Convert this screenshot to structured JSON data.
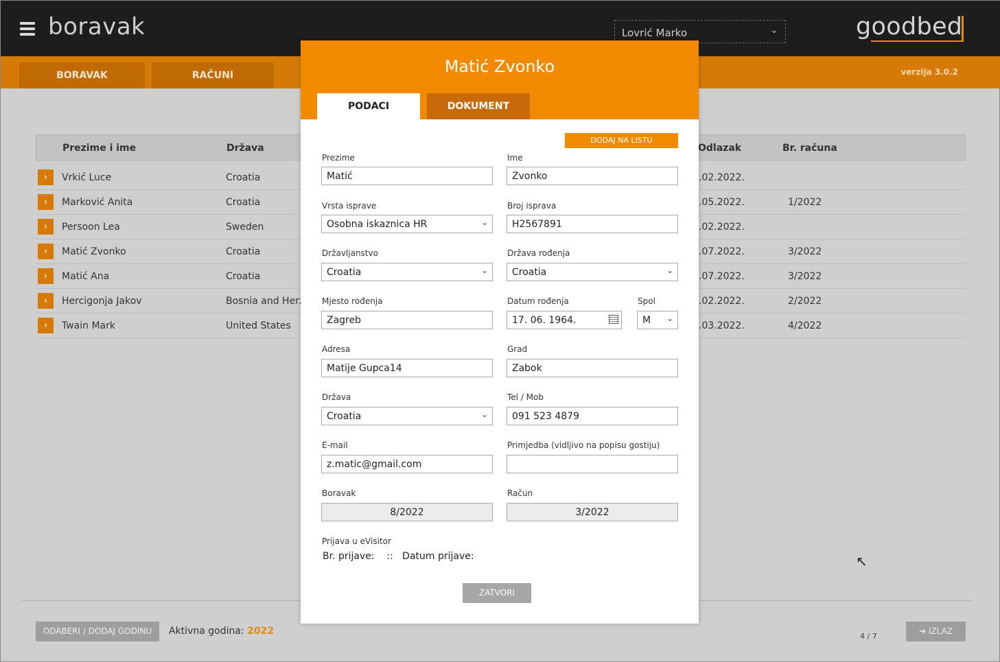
{
  "app": {
    "title": "boravak",
    "logo": "goodbed",
    "version": "verzija 3.0.2",
    "user": "Lovrić Marko"
  },
  "nav": {
    "tabs": [
      "BORAVAK",
      "RAČUNI"
    ]
  },
  "table": {
    "headers": {
      "name": "Prezime i ime",
      "country": "Država",
      "departure": "Odlazak",
      "invoice": "Br. računa"
    },
    "rows": [
      {
        "name": "Vrkić Luce",
        "country": "Croatia",
        "departure": ".02.2022.",
        "invoice": ""
      },
      {
        "name": "Marković Anita",
        "country": "Croatia",
        "departure": ".05.2022.",
        "invoice": "1/2022"
      },
      {
        "name": "Persoon Lea",
        "country": "Sweden",
        "departure": ".02.2022.",
        "invoice": ""
      },
      {
        "name": "Matić Zvonko",
        "country": "Croatia",
        "departure": ".07.2022.",
        "invoice": "3/2022"
      },
      {
        "name": "Matić Ana",
        "country": "Croatia",
        "departure": ".07.2022.",
        "invoice": "3/2022"
      },
      {
        "name": "Hercigonja Jakov",
        "country": "Bosnia and Herzeg",
        "departure": ".02.2022.",
        "invoice": "2/2022"
      },
      {
        "name": "Twain Mark",
        "country": "United States",
        "departure": ".03.2022.",
        "invoice": "4/2022"
      }
    ]
  },
  "footer": {
    "year_button": "ODABERI / DODAJ GODINU",
    "active_year_label": "Aktivna godina:",
    "active_year": "2022",
    "pager": "4 / 7",
    "exit": "IZLAZ"
  },
  "modal": {
    "title": "Matić Zvonko",
    "tabs": {
      "data": "PODACI",
      "document": "DOKUMENT"
    },
    "add_button": "DODAJ NA LISTU",
    "labels": {
      "surname": "Prezime",
      "name": "Ime",
      "doc_type": "Vrsta isprave",
      "doc_number": "Broj isprava",
      "citizenship": "Državljanstvo",
      "birth_country": "Država rođenja",
      "birth_place": "Mjesto rođenja",
      "birth_date": "Datum rođenja",
      "gender": "Spol",
      "address": "Adresa",
      "city": "Grad",
      "country": "Država",
      "phone": "Tel / Mob",
      "email": "E-mail",
      "note": "Primjedba (vidljivo na popisu gostiju)",
      "stay": "Boravak",
      "invoice": "Račun",
      "evisitor": "Prijava u eVisitor"
    },
    "values": {
      "surname": "Matić",
      "name": "Zvonko",
      "doc_type": "Osobna iskaznica HR",
      "doc_number": "H2567891",
      "citizenship": "Croatia",
      "birth_country": "Croatia",
      "birth_place": "Zagreb",
      "birth_date": "17. 06. 1964.",
      "gender": "M",
      "address": "Matije Gupca14",
      "city": "Zabok",
      "country": "Croatia",
      "phone": "091 523 4879",
      "email": "z.matic@gmail.com",
      "note": "",
      "stay": "8/2022",
      "invoice": "3/2022"
    },
    "evisitor_line": "Br. prijave:    ::   Datum prijave:",
    "close_button": "ZATVORI"
  }
}
